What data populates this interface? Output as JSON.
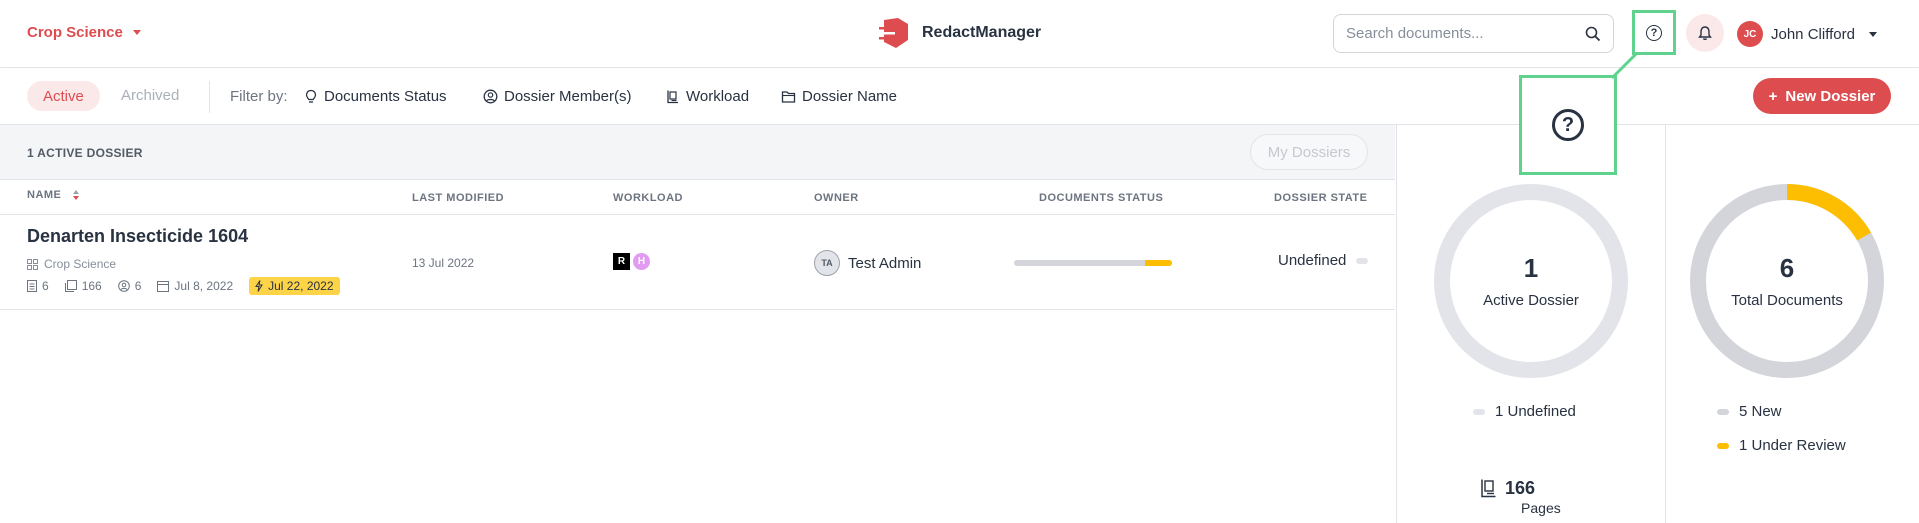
{
  "header": {
    "workspace": "Crop Science",
    "app_name": "RedactManager",
    "search_placeholder": "Search documents...",
    "user_initials": "JC",
    "user_name": "John Clifford"
  },
  "filterbar": {
    "tab_active": "Active",
    "tab_archived": "Archived",
    "filter_label": "Filter by:",
    "filters": [
      "Documents Status",
      "Dossier Member(s)",
      "Workload",
      "Dossier Name"
    ],
    "new_button": "New Dossier"
  },
  "list": {
    "count_label": "1 ACTIVE DOSSIER",
    "my_dossiers": "My Dossiers",
    "columns": {
      "name": "NAME",
      "last_modified": "LAST MODIFIED",
      "workload": "WORKLOAD",
      "owner": "OWNER",
      "documents_status": "DOCUMENTS STATUS",
      "dossier_state": "DOSSIER STATE"
    },
    "rows": [
      {
        "name": "Denarten Insecticide 1604",
        "template": "Crop Science",
        "docs": "6",
        "pages": "166",
        "members": "6",
        "created": "Jul 8, 2022",
        "due": "Jul 22, 2022",
        "last_modified": "13 Jul 2022",
        "workload_r": "R",
        "workload_h": "H",
        "owner_initials": "TA",
        "owner_name": "Test Admin",
        "status_progress": 0.17,
        "state": "Undefined"
      }
    ]
  },
  "stats": {
    "active_count": "1",
    "active_label": "Active Dossier",
    "active_legend": "1 Undefined",
    "total_count": "6",
    "total_label": "Total Documents",
    "total_legend": [
      "5 New",
      "1 Under Review"
    ],
    "total_fraction_review": 0.1667,
    "pages_count": "166",
    "pages_label": "Pages"
  },
  "colors": {
    "accent": "#dd4d50",
    "under_review": "#fdbd00",
    "new": "#d3d5da",
    "highlight": "#5fd38d"
  }
}
